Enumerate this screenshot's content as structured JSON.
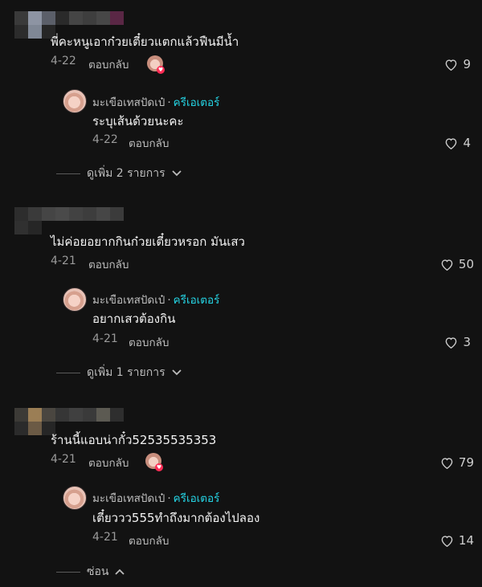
{
  "comments": [
    {
      "text": "พี่คะหนูเอาก๋วยเตี๋ยวแตกแล้วฟืนมีน้ำ",
      "date": "4-22",
      "reply_label": "ตอบกลับ",
      "likes": "9",
      "creator_liked": true,
      "reply": {
        "username": "มะเขือเทสปัดเป๋",
        "creator_label": "ครีเอเตอร์",
        "text": "ระบุเส้นด้วยนะคะ",
        "date": "4-22",
        "reply_label": "ตอบกลับ",
        "likes": "4"
      },
      "more_label": "ดูเพิ่ม 2 รายการ"
    },
    {
      "text": "ไม่ค่อยอยากกินก๋วยเตี๋ยวหรอก มันเสว",
      "date": "4-21",
      "reply_label": "ตอบกลับ",
      "likes": "50",
      "creator_liked": false,
      "reply": {
        "username": "มะเขือเทสปัดเป๋",
        "creator_label": "ครีเอเตอร์",
        "text": "อยากเสวต้องกิน",
        "date": "4-21",
        "reply_label": "ตอบกลับ",
        "likes": "3"
      },
      "more_label": "ดูเพิ่ม 1 รายการ"
    },
    {
      "text": "ร้านนี้แอบน่ากั๋ว52535535353",
      "date": "4-21",
      "reply_label": "ตอบกลับ",
      "likes": "79",
      "creator_liked": true,
      "reply": {
        "username": "มะเขือเทสปัดเป๋",
        "creator_label": "ครีเอเตอร์",
        "text": "เตี๋ยววว555ทำถึงมากต้องไปลอง",
        "date": "4-21",
        "reply_label": "ตอบกลับ",
        "likes": "14"
      },
      "more_label": "ซ่อน"
    }
  ],
  "colors": {
    "background": "#121212",
    "creator_accent": "#25d6e6",
    "like_badge": "#fe2c55"
  }
}
